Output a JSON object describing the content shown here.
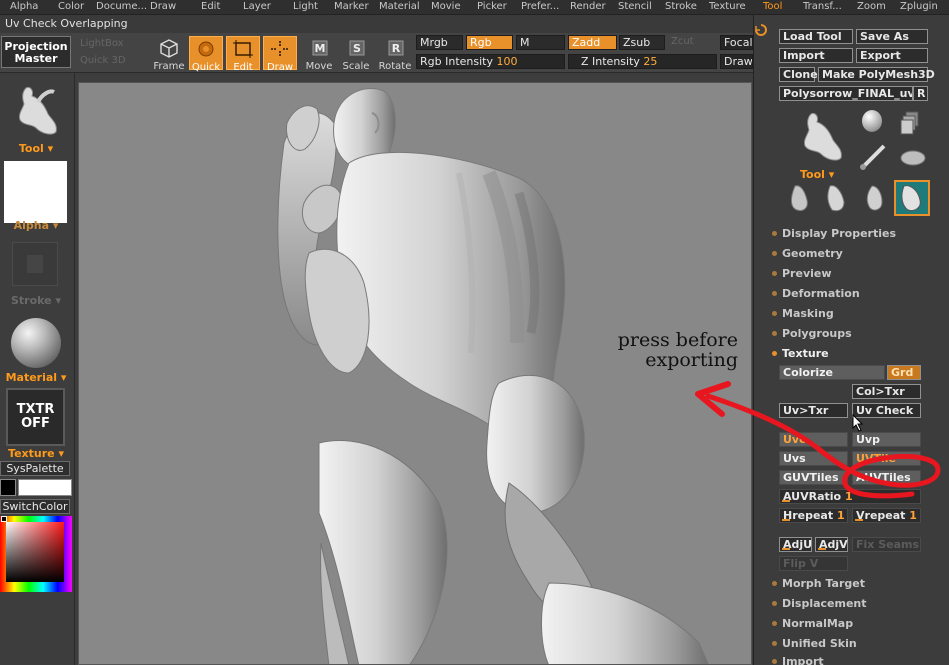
{
  "menu": {
    "items": [
      "Alpha",
      "Color",
      "Docume...",
      "Draw",
      "Edit",
      "Layer",
      "Light",
      "Marker",
      "Material",
      "Movie",
      "Picker",
      "Prefer...",
      "Render",
      "Stencil",
      "Stroke",
      "Texture",
      "Tool",
      "Transf...",
      "Zoom",
      "Zplugin"
    ],
    "active": "Tool"
  },
  "window_title": "Uv Check Overlapping",
  "toolbar": {
    "projection_master_line1": "Projection",
    "projection_master_line2": "Master",
    "ghost_row1": "LightBox",
    "ghost_row2": "Quick 3D",
    "frame": "Frame",
    "quick": "Quick",
    "edit": "Edit",
    "draw": "Draw",
    "move": "Move",
    "scale": "Scale",
    "rotate": "Rotate",
    "mrgb": "Mrgb",
    "rgb": "Rgb",
    "m": "M",
    "zadd": "Zadd",
    "zsub": "Zsub",
    "zcut": "Zcut",
    "rgb_intensity_label": "Rgb Intensity",
    "rgb_intensity_value": "100",
    "z_intensity_label": "Z Intensity",
    "z_intensity_value": "25",
    "focal_shift": "Focal Shift",
    "draw_size": "Draw Size"
  },
  "left_panel": {
    "tool_label": "Tool",
    "alpha_label": "Alpha",
    "stroke_label": "Stroke",
    "material_label": "Material",
    "texture_label": "Texture",
    "txtr_off_line1": "TXTR",
    "txtr_off_line2": "OFF",
    "syspalette": "SysPalette",
    "switchcolor": "SwitchColor"
  },
  "annotation": {
    "line1": "press before",
    "line2": "exporting"
  },
  "right_panel": {
    "load_tool": "Load Tool",
    "save_as": "Save As",
    "import": "Import",
    "export": "Export",
    "clone": "Clone",
    "make_polymesh3d": "Make PolyMesh3D",
    "current_tool": "Polysorrow_FINAL_uv",
    "r_button": "R",
    "tool_label": "Tool",
    "sections": [
      "Display Properties",
      "Geometry",
      "Preview",
      "Deformation",
      "Masking",
      "Polygroups",
      "Texture"
    ],
    "lower_sections": [
      "Morph Target",
      "Displacement",
      "NormalMap",
      "Unified Skin",
      "Import"
    ],
    "texture": {
      "colorize": "Colorize",
      "grd": "Grd",
      "col_txr": "Col>Txr",
      "uv_txr": "Uv>Txr",
      "uv_check": "Uv Check",
      "uvc": "Uvc",
      "uvp": "Uvp",
      "uvs": "Uvs",
      "uvtile": "UVTile",
      "guvtiles": "GUVTiles",
      "auvtiles": "AUVTiles",
      "auvratio": "AUVRatio",
      "auvratio_value": "1",
      "hrepeat": "Hrepeat",
      "hrepeat_value": "1",
      "vrepeat": "Vrepeat",
      "vrepeat_value": "1",
      "adju": "AdjU",
      "adjv": "AdjV",
      "ghost1": "Fix Seams",
      "ghost2": "Flip V"
    }
  },
  "colors": {
    "accent": "#e8902a",
    "canvas": "#888888",
    "panel": "#3c3c3c",
    "annotation_red": "#e8161e"
  },
  "icons": {
    "tool_thumb": "figure-icon",
    "material_thumb": "sphere-icon",
    "cursor": "arrow-cursor-icon"
  }
}
